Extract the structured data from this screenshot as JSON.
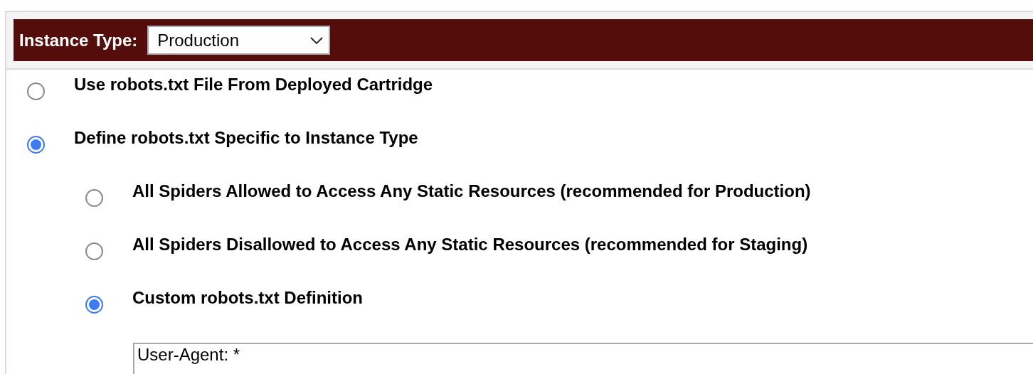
{
  "instance_type": {
    "label": "Instance Type:",
    "value": "Production"
  },
  "robots_options": [
    {
      "label": "Use robots.txt File From Deployed Cartridge",
      "selected": false
    },
    {
      "label": "Define robots.txt Specific to Instance Type",
      "selected": true,
      "children": [
        {
          "label": "All Spiders Allowed to Access Any Static Resources (recommended for Production)",
          "selected": false
        },
        {
          "label": "All Spiders Disallowed to Access Any Static Resources (recommended for Staging)",
          "selected": false
        },
        {
          "label": "Custom robots.txt Definition",
          "selected": true
        }
      ]
    }
  ],
  "custom_definition": {
    "value": "User-Agent: *"
  }
}
